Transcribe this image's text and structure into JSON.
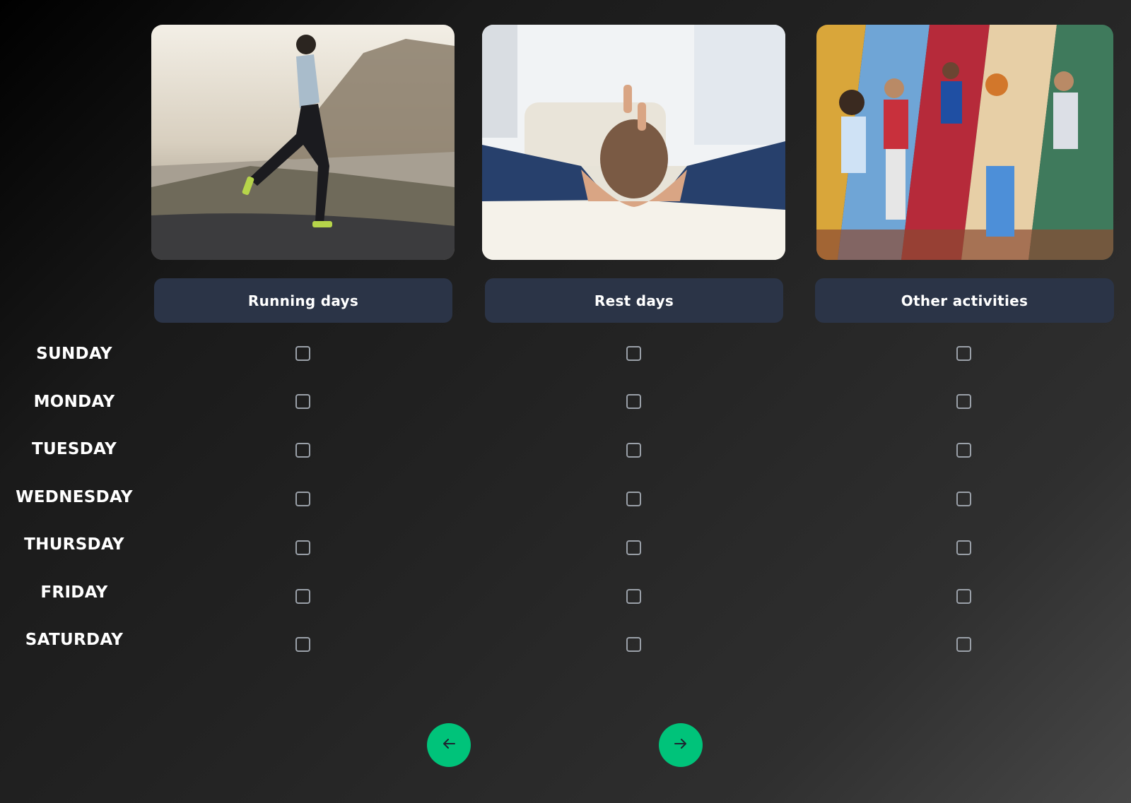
{
  "columns": [
    {
      "id": "running",
      "label": "Running days",
      "image": "runner-photo"
    },
    {
      "id": "rest",
      "label": "Rest days",
      "image": "relaxing-on-sofa-photo"
    },
    {
      "id": "other",
      "label": "Other activities",
      "image": "sports-collage-photo"
    }
  ],
  "days": [
    "SUNDAY",
    "MONDAY",
    "TUESDAY",
    "WEDNESDAY",
    "THURSDAY",
    "FRIDAY",
    "SATURDAY"
  ],
  "checked": {
    "running": [
      false,
      false,
      false,
      false,
      false,
      false,
      false
    ],
    "rest": [
      false,
      false,
      false,
      false,
      false,
      false,
      false
    ],
    "other": [
      false,
      false,
      false,
      false,
      false,
      false,
      false
    ]
  },
  "nav": {
    "prev_icon": "arrow-left-icon",
    "next_icon": "arrow-right-icon"
  },
  "colors": {
    "accent": "#00c37a",
    "header_bg": "#2b3447",
    "checkbox_border": "#9aa0a8"
  }
}
